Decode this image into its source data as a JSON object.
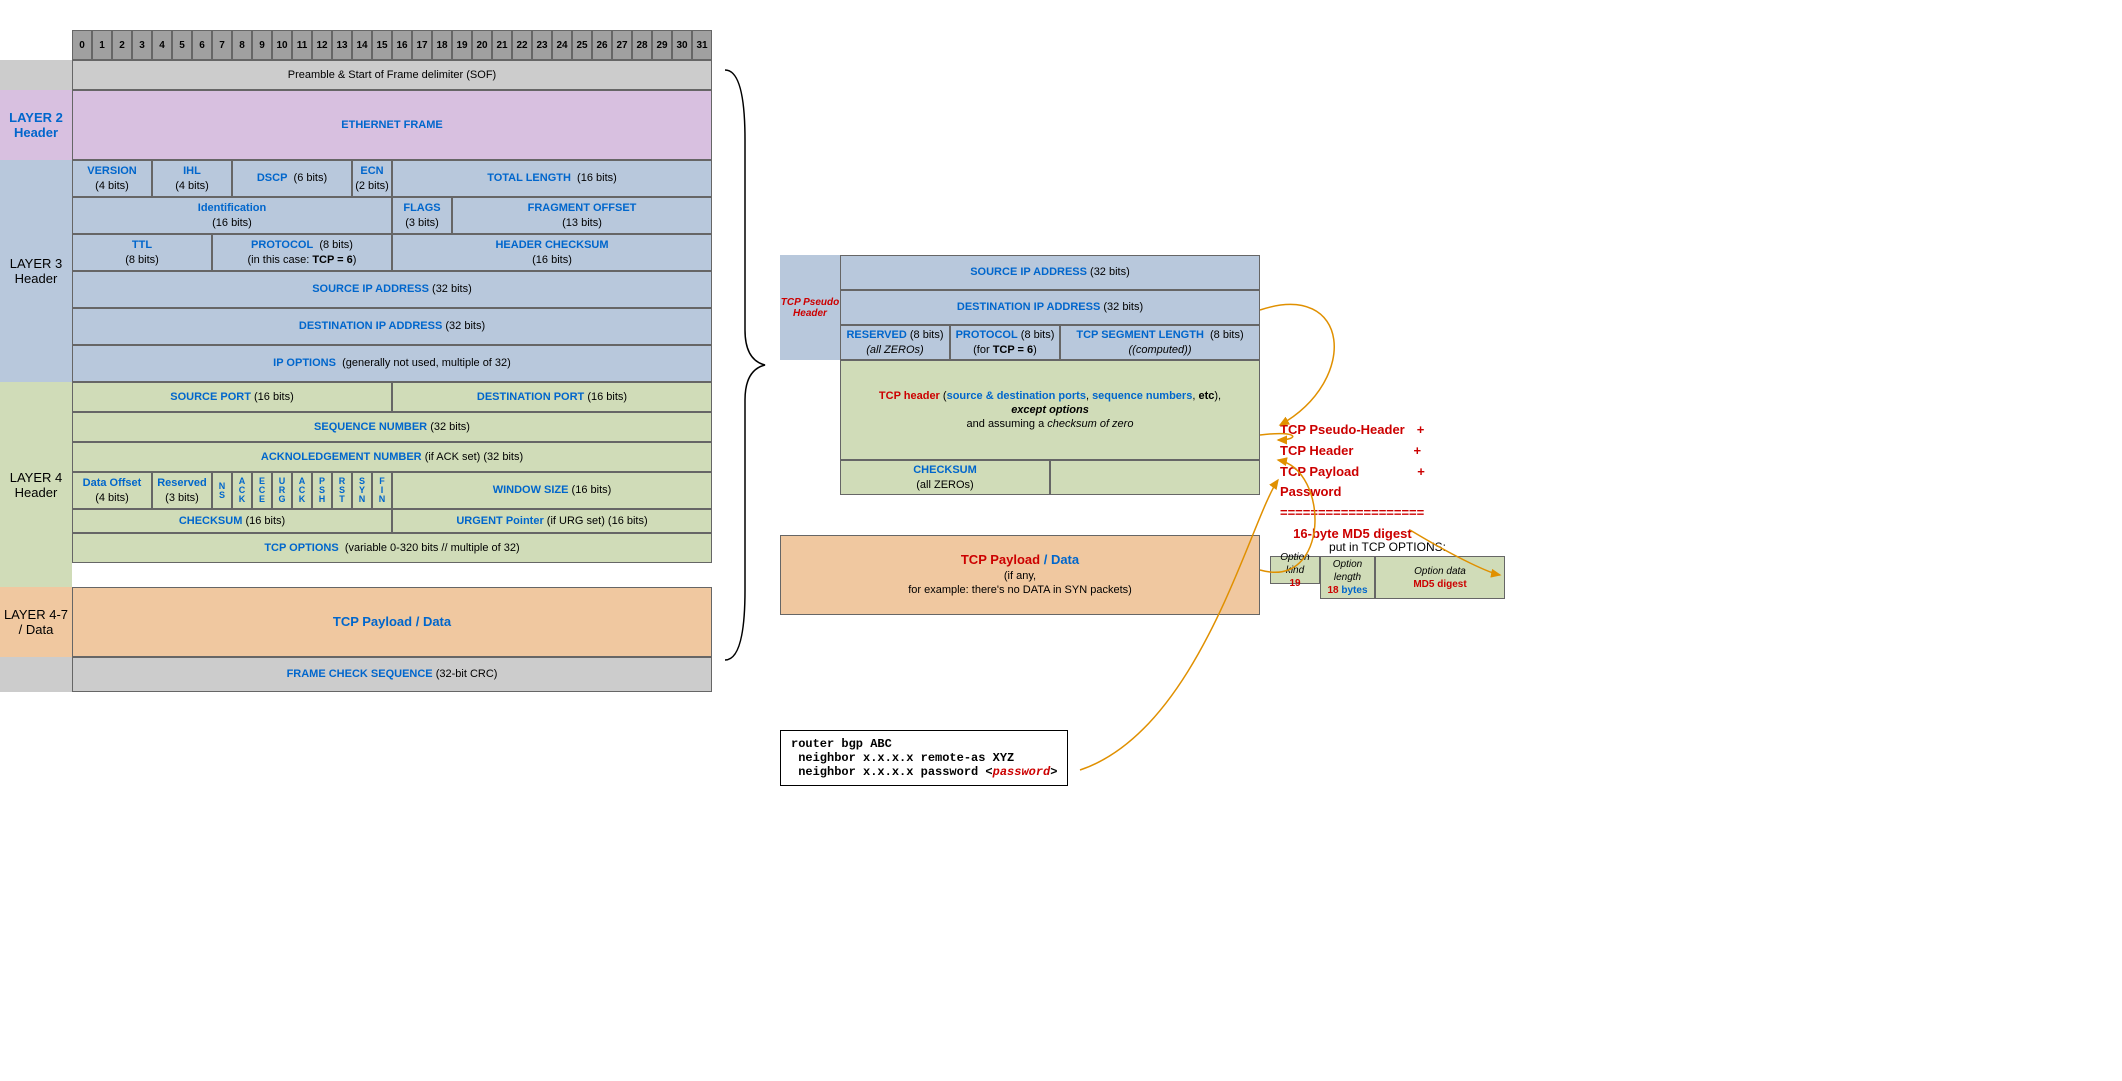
{
  "bits": [
    "0",
    "1",
    "2",
    "3",
    "4",
    "5",
    "6",
    "7",
    "8",
    "9",
    "10",
    "11",
    "12",
    "13",
    "14",
    "15",
    "16",
    "17",
    "18",
    "19",
    "20",
    "21",
    "22",
    "23",
    "24",
    "25",
    "26",
    "27",
    "28",
    "29",
    "30",
    "31"
  ],
  "preamble": "Preamble & Start of Frame delimiter (SOF)",
  "L2": {
    "label1": "LAYER  2",
    "label2": "Header",
    "eth": "ETHERNET  FRAME"
  },
  "L3": {
    "label1": "LAYER 3",
    "label2": "Header",
    "version": "VERSION",
    "version_sub": "(4 bits)",
    "ihl": "IHL",
    "ihl_sub": "(4 bits)",
    "dscp": "DSCP",
    "dscp_sub": "(6 bits)",
    "ecn": "ECN",
    "ecn_sub": "(2 bits)",
    "totlen": "TOTAL  LENGTH",
    "totlen_sub": "(16 bits)",
    "id": "Identification",
    "id_sub": "(16 bits)",
    "flags": "FLAGS",
    "flags_sub": "(3 bits)",
    "frag": "FRAGMENT  OFFSET",
    "frag_sub": "(13 bits)",
    "ttl": "TTL",
    "ttl_sub": "(8 bits)",
    "proto": "PROTOCOL",
    "proto_sub": "(8 bits)",
    "proto_note": "(in this case: ",
    "proto_val": "TCP = 6",
    "hcksum": "HEADER  CHECKSUM",
    "hcksum_sub": "(16 bits)",
    "srcip": "SOURCE  IP  ADDRESS",
    "srcip_sub": "(32 bits)",
    "dstip": "DESTINATION  IP  ADDRESS",
    "dstip_sub": "(32 bits)",
    "ipopt": "IP  OPTIONS",
    "ipopt_sub": "(generally not used, multiple of 32)"
  },
  "L4": {
    "label1": "LAYER 4",
    "label2": "Header",
    "sport": "SOURCE  PORT",
    "sport_sub": "(16 bits)",
    "dport": "DESTINATION  PORT",
    "dport_sub": "(16 bits)",
    "seq": "SEQUENCE  NUMBER",
    "seq_sub": "(32 bits)",
    "ack": "ACKNOLEDGEMENT  NUMBER",
    "ack_sub": "(if ACK set) (32 bits)",
    "doff": "Data Offset",
    "doff_sub": "(4 bits)",
    "res": "Reserved",
    "res_sub": "(3 bits)",
    "flags": [
      "N S",
      "A C K",
      "E C E",
      "U R G",
      "A C K",
      "P S H",
      "R S T",
      "S Y N",
      "F I N"
    ],
    "win": "WINDOW SIZE",
    "win_sub": "(16 bits)",
    "cksum": "CHECKSUM",
    "cksum_sub": "(16 bits)",
    "urg": "URGENT Pointer",
    "urg_sub": "(if URG set) (16 bits)",
    "tcpopt": "TCP  OPTIONS",
    "tcpopt_sub": "(variable 0-320 bits // multiple of 32)"
  },
  "data": {
    "label1": "LAYER 4-7",
    "label2": "/ Data",
    "pay": "TCP  Payload / Data"
  },
  "fcs": "FRAME  CHECK  SEQUENCE",
  "fcs_sub": "(32-bit CRC)",
  "pseudo": {
    "label": "TCP Pseudo Header",
    "srcip": "SOURCE  IP  ADDRESS",
    "srcip_sub": "(32 bits)",
    "dstip": "DESTINATION  IP  ADDRESS",
    "dstip_sub": "(32 bits)",
    "res": "RESERVED",
    "res_sub": "(8 bits)",
    "res_note": "(all ZEROs)",
    "proto": "PROTOCOL",
    "proto_sub": "(8 bits)",
    "proto_note": "(for ",
    "proto_val": "TCP = 6",
    "seglen": "TCP  SEGMENT  LENGTH",
    "seglen_sub": "(8 bits)",
    "seglen_note": "(computed)"
  },
  "tcpbox": {
    "hdr": "TCP header",
    "p1": "(",
    "a": "source & destination ports",
    "c": ", ",
    "b": "sequence numbers",
    "c2": ", ",
    "e": "etc",
    "p2": "),",
    "opt": "except options",
    "assume": "and assuming a ",
    "ckz": "checksum of zero",
    "cksum": "CHECKSUM",
    "cksum_note": "(all ZEROs)"
  },
  "paybox": {
    "t1": "TCP  Payload",
    "slash": " / ",
    "t2": "Data",
    "ifany": "(if any,",
    "eg": "for example: there's no DATA in SYN packets)"
  },
  "sum": {
    "l1": "TCP Pseudo-Header",
    "l2": "TCP Header",
    "l3": "TCP Payload",
    "l4": "Password",
    "eq": "===================",
    "md5": "16-byte MD5 digest",
    "plus": "+"
  },
  "opt": {
    "put": "put in TCP OPTIONS:",
    "k": "Option kind",
    "kv": "19",
    "l": "Option length",
    "lv": "18",
    "lb": "bytes",
    "d": "Option data",
    "dv": "MD5 digest"
  },
  "code": {
    "l1": "router bgp ABC",
    "l2": " neighbor x.x.x.x remote-as XYZ",
    "l3": " neighbor x.x.x.x password <",
    "pw": "password",
    "l3b": ">"
  }
}
